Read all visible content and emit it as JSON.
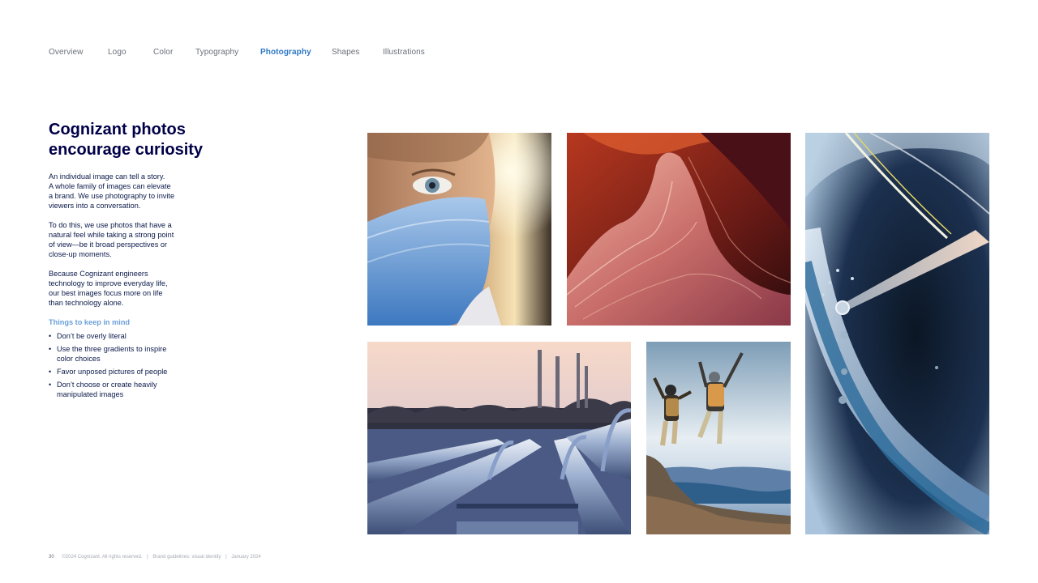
{
  "nav": {
    "items": [
      {
        "label": "Overview"
      },
      {
        "label": "Logo"
      },
      {
        "label": "Color"
      },
      {
        "label": "Typography"
      },
      {
        "label": "Photography",
        "active": true
      },
      {
        "label": "Shapes"
      },
      {
        "label": "Illustrations"
      }
    ]
  },
  "main": {
    "title_lines": [
      "Cognizant photos",
      "encourage curiosity"
    ],
    "paragraphs": [
      [
        "An individual image can tell a story.",
        "A whole family of images can elevate",
        "a brand. We use photography to invite",
        "viewers into a conversation."
      ],
      [
        "To do this, we use photos that have a",
        "natural feel while taking a strong point",
        "of view—be it broad perspectives or",
        "close-up moments."
      ],
      [
        "Because Cognizant engineers",
        "technology to improve everyday life,",
        "our best images focus more on life",
        "than technology alone."
      ]
    ],
    "mind_heading": "Things to keep in mind",
    "bullets": [
      [
        "Don’t be overly literal"
      ],
      [
        "Use the three gradients to inspire",
        "color choices"
      ],
      [
        "Favor unposed pictures of people"
      ],
      [
        "Don’t choose or create heavily",
        "manipulated images"
      ]
    ],
    "bullet_glyph": "•"
  },
  "footer": {
    "page_number": "30",
    "copyright": "©2024 Cognizant. All rights reserved.",
    "separator": "|",
    "doc_title": "Brand guidelines: visual identity",
    "date": "January 2024"
  },
  "colors": {
    "title": "#000048",
    "text": "#0b1a4a",
    "active_nav": "#2f78c4",
    "mind_heading": "#6b9fd8",
    "muted": "#6b6f7a"
  }
}
